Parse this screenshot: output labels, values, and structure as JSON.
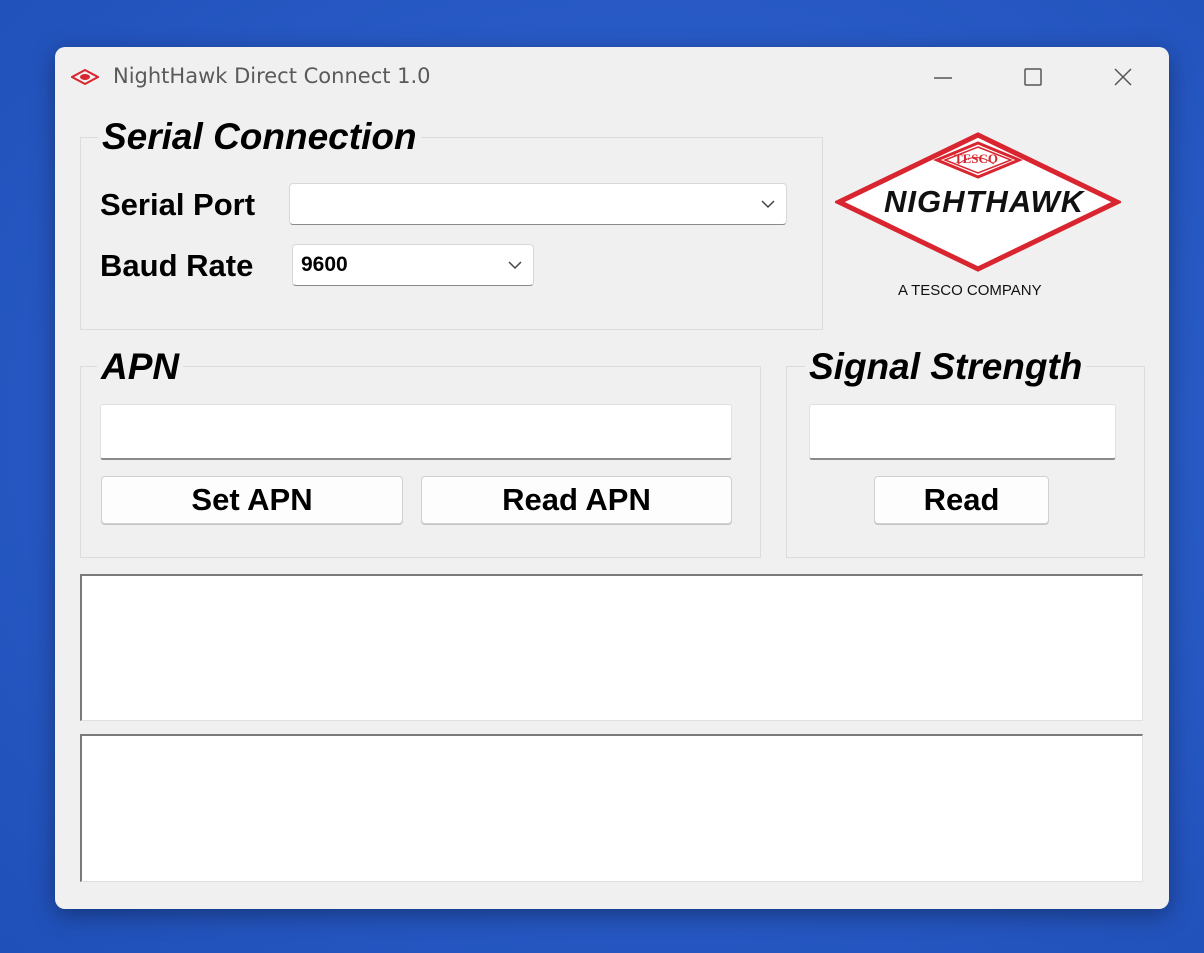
{
  "window": {
    "title": "NightHawk Direct Connect 1.0",
    "icon": "tesco-app-icon",
    "controls": [
      "minimize-icon",
      "maximize-icon",
      "close-icon"
    ]
  },
  "serial_connection": {
    "title": "Serial Connection",
    "serial_port_label": "Serial Port",
    "serial_port_value": "",
    "baud_rate_label": "Baud Rate",
    "baud_rate_value": "9600"
  },
  "logo": {
    "badge_text": "TESCO",
    "brand": "NIGHTHAWK",
    "tagline": "A TESCO COMPANY",
    "color": "#d9252f"
  },
  "apn": {
    "title": "APN",
    "value": "",
    "set_button": "Set APN",
    "read_button": "Read APN"
  },
  "signal": {
    "title": "Signal Strength",
    "value": "",
    "read_button": "Read"
  },
  "output": {
    "box1": "",
    "box2": ""
  }
}
